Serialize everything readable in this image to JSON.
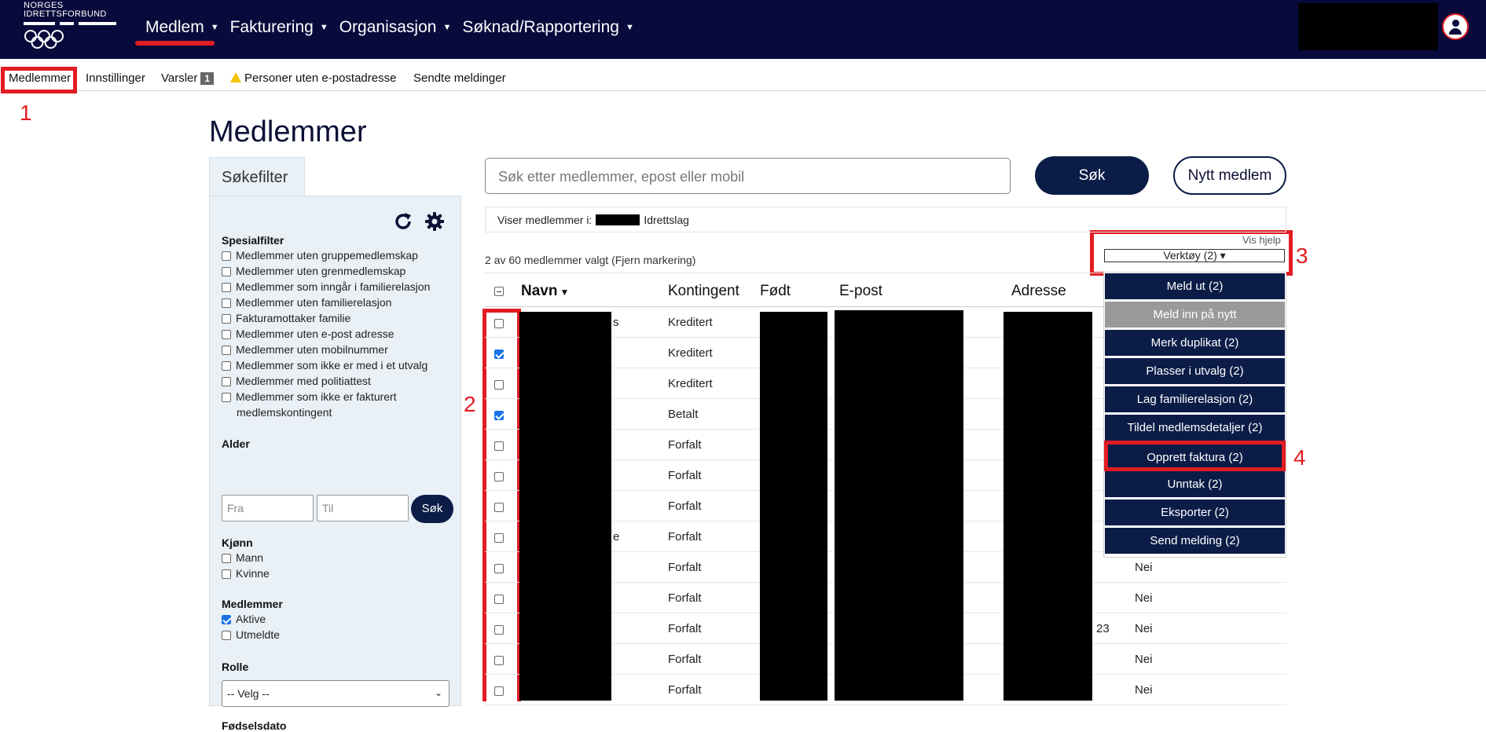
{
  "logo": {
    "line1": "NORGES",
    "line2": "IDRETTSFORBUND"
  },
  "main_nav": [
    {
      "label": "Medlem"
    },
    {
      "label": "Fakturering"
    },
    {
      "label": "Organisasjon"
    },
    {
      "label": "Søknad/Rapportering"
    }
  ],
  "sub_nav": {
    "medlemmer": "Medlemmer",
    "innstillinger": "Innstillinger",
    "varsler": "Varsler",
    "varsler_count": "1",
    "personer": "Personer uten e-postadresse",
    "sendte": "Sendte meldinger"
  },
  "annotations": {
    "n1": "1",
    "n2": "2",
    "n3": "3",
    "n4": "4"
  },
  "page_title": "Medlemmer",
  "filter": {
    "tab": "Søkefilter",
    "special_title": "Spesialfilter",
    "special": [
      "Medlemmer uten gruppemedlemskap",
      "Medlemmer uten grenmedlemskap",
      "Medlemmer som inngår i familierelasjon",
      "Medlemmer uten familierelasjon",
      "Fakturamottaker familie",
      "Medlemmer uten e-post adresse",
      "Medlemmer uten mobilnummer",
      "Medlemmer som ikke er med i et utvalg",
      "Medlemmer med politiattest",
      "Medlemmer som ikke er fakturert",
      "medlemskontingent"
    ],
    "age_title": "Alder",
    "age_from_placeholder": "Fra",
    "age_to_placeholder": "Til",
    "age_button": "Søk",
    "gender_title": "Kjønn",
    "gender_male": "Mann",
    "gender_female": "Kvinne",
    "members_title": "Medlemmer",
    "members_active": "Aktive",
    "members_resigned": "Utmeldte",
    "role_title": "Rolle",
    "role_value": "-- Velg --",
    "birthdate_title": "Fødselsdato"
  },
  "search": {
    "placeholder": "Søk etter medlemmer, epost eller mobil",
    "button": "Søk",
    "new_member": "Nytt medlem"
  },
  "showing": {
    "prefix": "Viser medlemmer i:",
    "suffix": "Idrettslag"
  },
  "help_link": "Vis hjelp",
  "selected_text": "2 av 60 medlemmer valgt (Fjern markering)",
  "tools_button": "Verktøy (2) ▾",
  "table": {
    "headers": [
      "Navn",
      "Kontingent",
      "Født",
      "E-post",
      "Adresse"
    ],
    "rows": [
      {
        "kontingent": "Kreditert",
        "checked": false,
        "name_tail": "s"
      },
      {
        "kontingent": "Kreditert",
        "checked": true
      },
      {
        "kontingent": "Kreditert",
        "checked": false
      },
      {
        "kontingent": "Betalt",
        "checked": true
      },
      {
        "kontingent": "Forfalt",
        "checked": false
      },
      {
        "kontingent": "Forfalt",
        "checked": false
      },
      {
        "kontingent": "Forfalt",
        "checked": false
      },
      {
        "kontingent": "Forfalt",
        "checked": false,
        "name_tail": "e"
      },
      {
        "kontingent": "Forfalt",
        "checked": false,
        "col7": "Nei"
      },
      {
        "kontingent": "Forfalt",
        "checked": false,
        "col7": "Nei"
      },
      {
        "kontingent": "Forfalt",
        "checked": false,
        "address_tail": "23",
        "col7": "Nei"
      },
      {
        "kontingent": "Forfalt",
        "checked": false,
        "col7": "Nei"
      },
      {
        "kontingent": "Forfalt",
        "checked": false,
        "col7": "Nei"
      }
    ]
  },
  "tools_menu": [
    {
      "label": "Meld ut (2)"
    },
    {
      "label": "Meld inn på nytt",
      "disabled": true
    },
    {
      "label": "Merk duplikat (2)"
    },
    {
      "label": "Plasser i utvalg (2)"
    },
    {
      "label": "Lag familierelasjon (2)"
    },
    {
      "label": "Tildel medlemsdetaljer (2)"
    },
    {
      "label": "Opprett faktura (2)",
      "highlighted": true
    },
    {
      "label": "Unntak (2)"
    },
    {
      "label": "Eksporter (2)"
    },
    {
      "label": "Send melding (2)"
    }
  ],
  "colors": {
    "navy": "#080a3c",
    "button": "#0b1c47",
    "annotation": "#e21c23",
    "panel": "#e9f0f6"
  }
}
